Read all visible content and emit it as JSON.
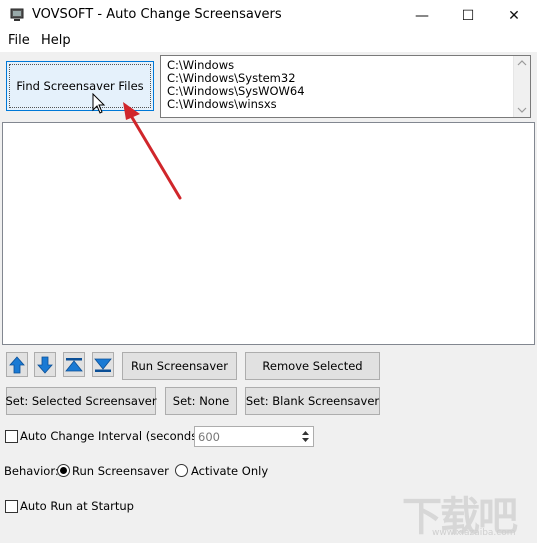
{
  "window": {
    "title": "VOVSOFT - Auto Change Screensavers"
  },
  "captions": {
    "minimize": "—",
    "maximize": "☐",
    "close": "✕"
  },
  "menu": [
    "File",
    "Help"
  ],
  "find_button": "Find Screensaver Files",
  "folders": [
    "C:\\Windows",
    "C:\\Windows\\System32",
    "C:\\Windows\\SysWOW64",
    "C:\\Windows\\winsxs"
  ],
  "buttons": {
    "run": "Run Screensaver",
    "remove": "Remove Selected",
    "set_selected": "Set: Selected Screensaver",
    "set_none": "Set: None",
    "set_blank": "Set: Blank Screensaver"
  },
  "arrow_icons": [
    "move-up-icon",
    "move-down-icon",
    "move-top-icon",
    "move-bottom-icon"
  ],
  "interval": {
    "label": "Auto Change Interval (seconds):",
    "value": "600",
    "checked": false
  },
  "behavior": {
    "label": "Behavior:",
    "options": [
      "Run Screensaver",
      "Activate Only"
    ],
    "selected": "Run Screensaver"
  },
  "autorun": {
    "label": "Auto Run at Startup",
    "checked": false
  },
  "watermark": {
    "text": "下载吧",
    "url": "www.xiazaiba.com"
  },
  "colors": {
    "accent": "#0078d7",
    "arrow_red": "#d0262b",
    "icon_blue": "#1a7ad4"
  }
}
